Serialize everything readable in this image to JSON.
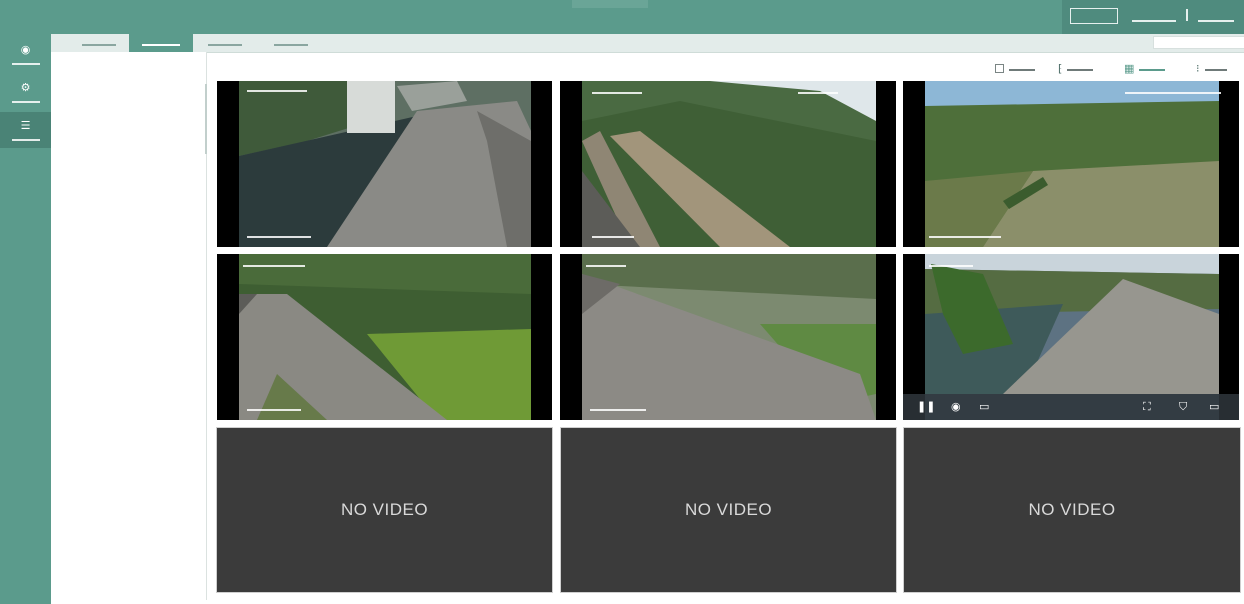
{
  "top_bar": {
    "action_label": "",
    "user_label": "",
    "logout_label": ""
  },
  "sidebar": {
    "items": [
      {
        "icon": "globe-icon",
        "label": ""
      },
      {
        "icon": "settings-icon",
        "label": ""
      },
      {
        "icon": "list-icon",
        "label": ""
      }
    ]
  },
  "tabs": [
    {
      "label": ""
    },
    {
      "label": ""
    },
    {
      "label": ""
    },
    {
      "label": ""
    }
  ],
  "device_select": {
    "value": ""
  },
  "toolbar": {
    "items": [
      {
        "label": ""
      },
      {
        "label": ""
      },
      {
        "label": ""
      },
      {
        "label": ""
      }
    ]
  },
  "grid": {
    "columns": 3,
    "rows": 3,
    "tiles": [
      {
        "status": "live",
        "overlay": ""
      },
      {
        "status": "live",
        "overlay": ""
      },
      {
        "status": "live",
        "overlay": ""
      },
      {
        "status": "live",
        "overlay": ""
      },
      {
        "status": "live",
        "overlay": ""
      },
      {
        "status": "live",
        "overlay": ""
      },
      {
        "status": "no_signal",
        "text": "NO VIDEO"
      },
      {
        "status": "no_signal",
        "text": "NO VIDEO"
      },
      {
        "status": "no_signal",
        "text": "NO VIDEO"
      }
    ]
  },
  "colors": {
    "accent": "#5b9b8c",
    "accent_dark": "#4a8376",
    "no_video_bg": "#3b3b3b"
  }
}
